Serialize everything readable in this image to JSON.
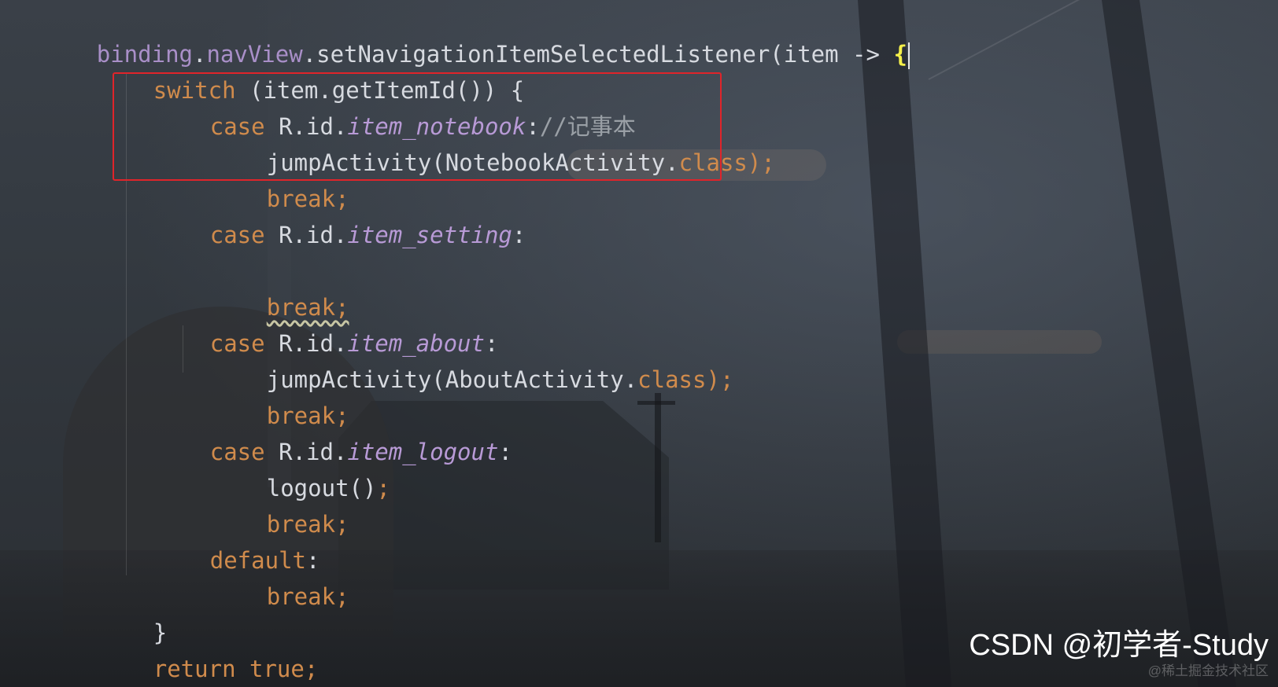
{
  "editor": {
    "lines": [
      {
        "parts": [
          "binding",
          ".",
          "navView",
          ".setNavigationItemSelectedListener(item -> ",
          "{"
        ]
      },
      {
        "parts": [
          "switch",
          " (item.getItemId()) {"
        ]
      },
      {
        "parts": [
          "case",
          " R.id.",
          "item_notebook",
          ":",
          "//记事本"
        ]
      },
      {
        "parts": [
          "jumpActivity(NotebookActivity.",
          "class",
          ");"
        ]
      },
      {
        "parts": [
          "break",
          ";"
        ]
      },
      {
        "parts": [
          "case",
          " R.id.",
          "item_setting",
          ":"
        ]
      },
      {
        "parts": [
          ""
        ]
      },
      {
        "parts": [
          "break;"
        ]
      },
      {
        "parts": [
          "case",
          " R.id.",
          "item_about",
          ":"
        ]
      },
      {
        "parts": [
          "jumpActivity(AboutActivity.",
          "class",
          ");"
        ]
      },
      {
        "parts": [
          "break",
          ";"
        ]
      },
      {
        "parts": [
          "case",
          " R.id.",
          "item_logout",
          ":"
        ]
      },
      {
        "parts": [
          "logout()",
          ";"
        ]
      },
      {
        "parts": [
          "break",
          ";"
        ]
      },
      {
        "parts": [
          "default",
          ":"
        ]
      },
      {
        "parts": [
          "break",
          ";"
        ]
      },
      {
        "parts": [
          "}"
        ]
      },
      {
        "parts": [
          "return true",
          ";"
        ]
      },
      {
        "parts": [
          "}",
          ");"
        ]
      }
    ]
  },
  "watermark": {
    "main": "CSDN @初学者-Study",
    "faint": "@稀土掘金技术社区"
  },
  "colors": {
    "keyword": "#d08b4c",
    "field": "#a98fc8",
    "text": "#d7dae0",
    "comment": "#9aa0a6",
    "brace_match": "#f5f04a",
    "box": "#e0242a"
  }
}
